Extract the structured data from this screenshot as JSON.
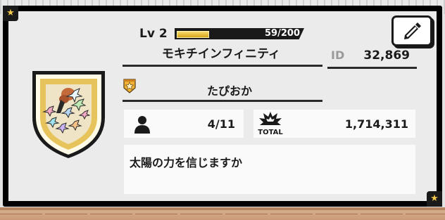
{
  "profile": {
    "level_label": "Lv 2",
    "xp_text": "59/200",
    "xp_progress": 0.295,
    "player_name": "モキチインフィニティ",
    "id_label": "ID",
    "id_value": "32,869",
    "title": "たぴおか",
    "friends_value": "4/11",
    "total_label": "TOTAL",
    "total_value": "1,714,311",
    "comment": "太陽の力を信じますか"
  },
  "icons": {
    "edit": "pencil-icon",
    "friends": "person-icon",
    "total": "burst-icon",
    "rank": "rank-star-badge-icon",
    "emblem": "shield-emblem-icon",
    "corner": "star-icon"
  },
  "colors": {
    "xp_fill": "#f1c84a",
    "card_border": "#000000",
    "panel": "#fafafa",
    "id_label": "#9a9a9a"
  }
}
